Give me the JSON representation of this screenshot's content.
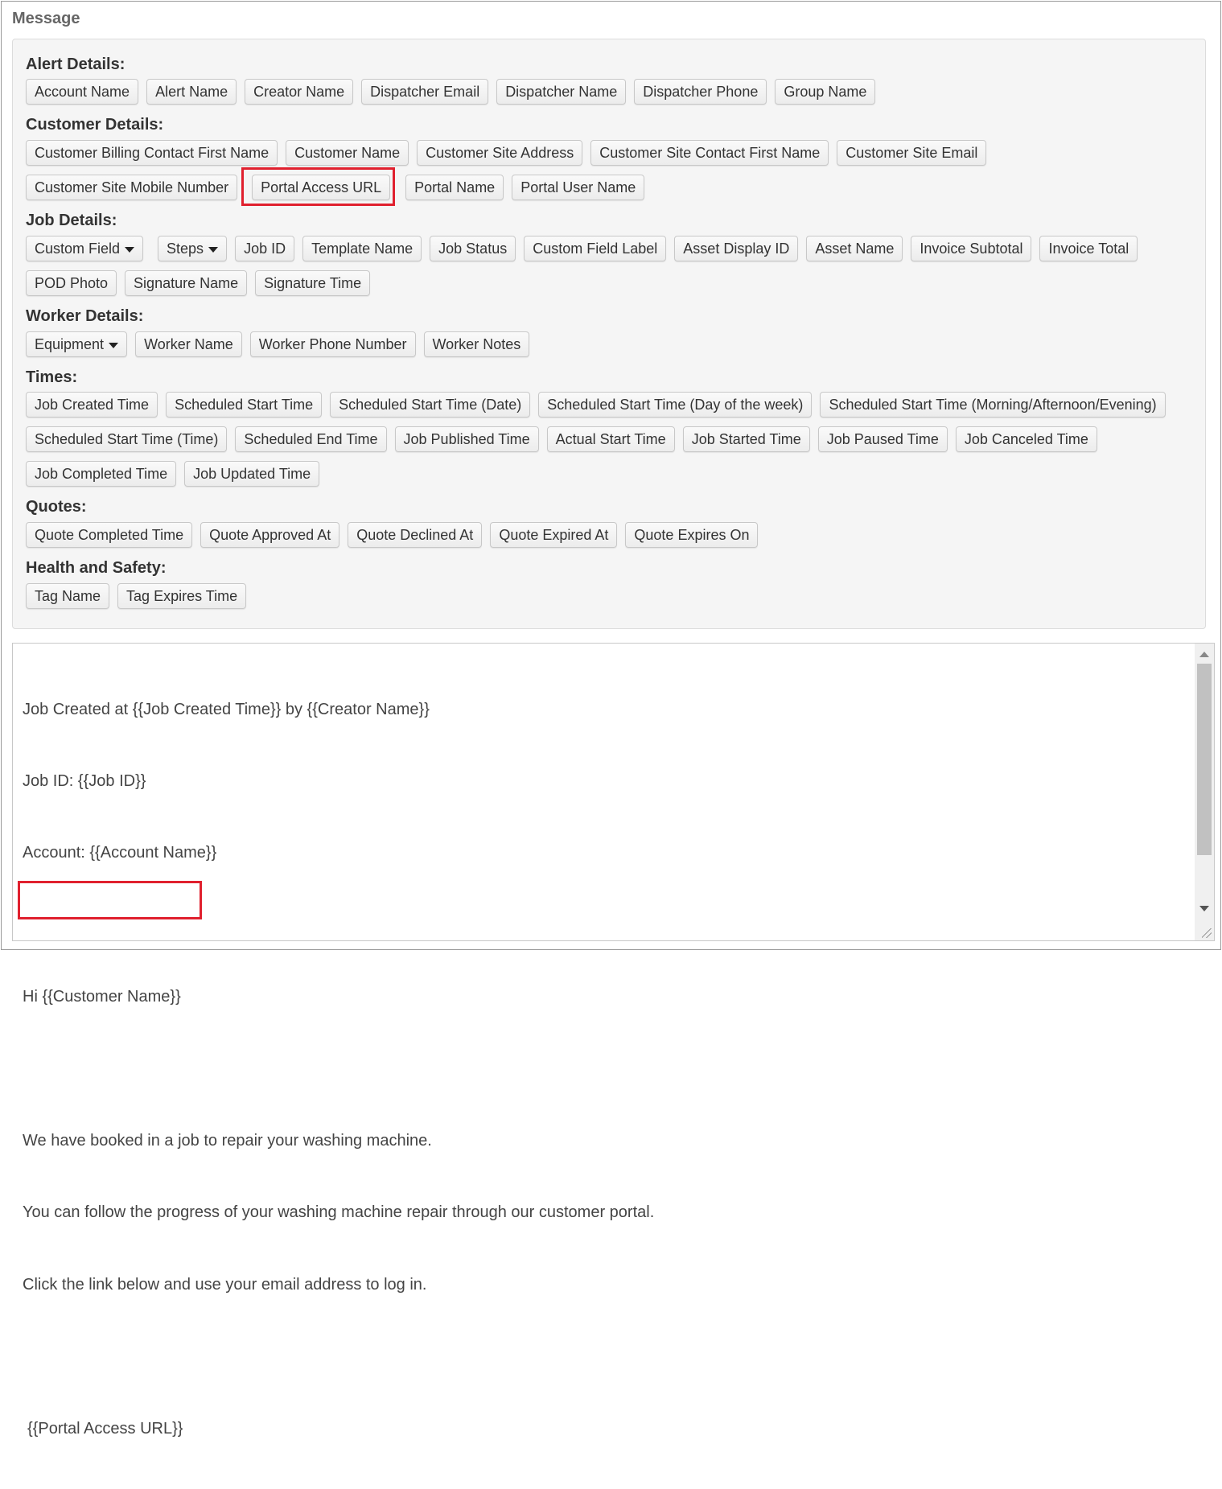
{
  "section_title": "Message",
  "groups": {
    "alert": {
      "title": "Alert Details:",
      "buttons": [
        "Account Name",
        "Alert Name",
        "Creator Name",
        "Dispatcher Email",
        "Dispatcher Name",
        "Dispatcher Phone",
        "Group Name"
      ]
    },
    "customer": {
      "title": "Customer Details:",
      "buttons": [
        "Customer Billing Contact First Name",
        "Customer Name",
        "Customer Site Address",
        "Customer Site Contact First Name",
        "Customer Site Email",
        "Customer Site Mobile Number",
        "Portal Access URL",
        "Portal Name",
        "Portal User Name"
      ]
    },
    "job": {
      "title": "Job Details:",
      "buttons": [
        "Custom Field",
        "Steps",
        "Job ID",
        "Template Name",
        "Job Status",
        "Custom Field Label",
        "Asset Display ID",
        "Asset Name",
        "Invoice Subtotal",
        "Invoice Total",
        "POD Photo",
        "Signature Name",
        "Signature Time"
      ]
    },
    "worker": {
      "title": "Worker Details:",
      "buttons": [
        "Equipment",
        "Worker Name",
        "Worker Phone Number",
        "Worker Notes"
      ]
    },
    "times": {
      "title": "Times:",
      "buttons": [
        "Job Created Time",
        "Scheduled Start Time",
        "Scheduled Start Time (Date)",
        "Scheduled Start Time (Day of the week)",
        "Scheduled Start Time (Morning/Afternoon/Evening)",
        "Scheduled Start Time (Time)",
        "Scheduled End Time",
        "Job Published Time",
        "Actual Start Time",
        "Job Started Time",
        "Job Paused Time",
        "Job Canceled Time",
        "Job Completed Time",
        "Job Updated Time"
      ]
    },
    "quotes": {
      "title": "Quotes:",
      "buttons": [
        "Quote Completed Time",
        "Quote Approved At",
        "Quote Declined At",
        "Quote Expired At",
        "Quote Expires On"
      ]
    },
    "health": {
      "title": "Health and Safety:",
      "buttons": [
        "Tag Name",
        "Tag Expires Time"
      ]
    }
  },
  "editor": {
    "lines": [
      "Job Created at {{Job Created Time}} by {{Creator Name}}",
      "Job ID: {{Job ID}}",
      "Account: {{Account Name}}",
      "",
      "Hi {{Customer Name}}",
      "",
      "We have booked in a job to repair your washing machine.",
      "You can follow the progress of your washing machine repair through our customer portal.",
      "Click the link below and use your email address to log in.",
      "",
      "{{Portal Access URL}}"
    ]
  },
  "colors": {
    "highlight": "#e0202e",
    "panel_bg": "#f5f5f5"
  }
}
